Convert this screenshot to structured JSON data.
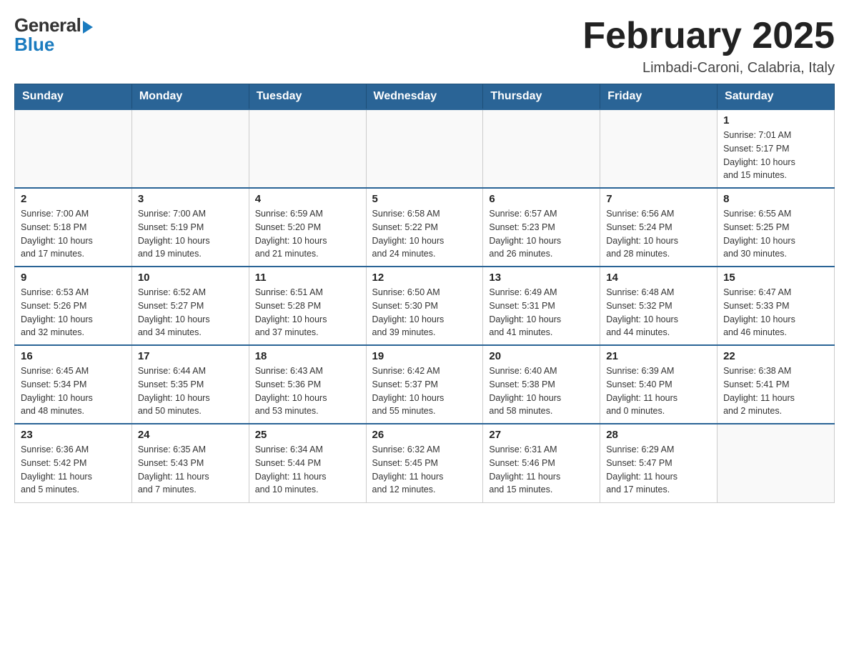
{
  "header": {
    "logo": {
      "general": "General",
      "blue": "Blue"
    },
    "title": "February 2025",
    "subtitle": "Limbadi-Caroni, Calabria, Italy"
  },
  "weekdays": [
    "Sunday",
    "Monday",
    "Tuesday",
    "Wednesday",
    "Thursday",
    "Friday",
    "Saturday"
  ],
  "weeks": [
    [
      {
        "day": "",
        "info": ""
      },
      {
        "day": "",
        "info": ""
      },
      {
        "day": "",
        "info": ""
      },
      {
        "day": "",
        "info": ""
      },
      {
        "day": "",
        "info": ""
      },
      {
        "day": "",
        "info": ""
      },
      {
        "day": "1",
        "info": "Sunrise: 7:01 AM\nSunset: 5:17 PM\nDaylight: 10 hours\nand 15 minutes."
      }
    ],
    [
      {
        "day": "2",
        "info": "Sunrise: 7:00 AM\nSunset: 5:18 PM\nDaylight: 10 hours\nand 17 minutes."
      },
      {
        "day": "3",
        "info": "Sunrise: 7:00 AM\nSunset: 5:19 PM\nDaylight: 10 hours\nand 19 minutes."
      },
      {
        "day": "4",
        "info": "Sunrise: 6:59 AM\nSunset: 5:20 PM\nDaylight: 10 hours\nand 21 minutes."
      },
      {
        "day": "5",
        "info": "Sunrise: 6:58 AM\nSunset: 5:22 PM\nDaylight: 10 hours\nand 24 minutes."
      },
      {
        "day": "6",
        "info": "Sunrise: 6:57 AM\nSunset: 5:23 PM\nDaylight: 10 hours\nand 26 minutes."
      },
      {
        "day": "7",
        "info": "Sunrise: 6:56 AM\nSunset: 5:24 PM\nDaylight: 10 hours\nand 28 minutes."
      },
      {
        "day": "8",
        "info": "Sunrise: 6:55 AM\nSunset: 5:25 PM\nDaylight: 10 hours\nand 30 minutes."
      }
    ],
    [
      {
        "day": "9",
        "info": "Sunrise: 6:53 AM\nSunset: 5:26 PM\nDaylight: 10 hours\nand 32 minutes."
      },
      {
        "day": "10",
        "info": "Sunrise: 6:52 AM\nSunset: 5:27 PM\nDaylight: 10 hours\nand 34 minutes."
      },
      {
        "day": "11",
        "info": "Sunrise: 6:51 AM\nSunset: 5:28 PM\nDaylight: 10 hours\nand 37 minutes."
      },
      {
        "day": "12",
        "info": "Sunrise: 6:50 AM\nSunset: 5:30 PM\nDaylight: 10 hours\nand 39 minutes."
      },
      {
        "day": "13",
        "info": "Sunrise: 6:49 AM\nSunset: 5:31 PM\nDaylight: 10 hours\nand 41 minutes."
      },
      {
        "day": "14",
        "info": "Sunrise: 6:48 AM\nSunset: 5:32 PM\nDaylight: 10 hours\nand 44 minutes."
      },
      {
        "day": "15",
        "info": "Sunrise: 6:47 AM\nSunset: 5:33 PM\nDaylight: 10 hours\nand 46 minutes."
      }
    ],
    [
      {
        "day": "16",
        "info": "Sunrise: 6:45 AM\nSunset: 5:34 PM\nDaylight: 10 hours\nand 48 minutes."
      },
      {
        "day": "17",
        "info": "Sunrise: 6:44 AM\nSunset: 5:35 PM\nDaylight: 10 hours\nand 50 minutes."
      },
      {
        "day": "18",
        "info": "Sunrise: 6:43 AM\nSunset: 5:36 PM\nDaylight: 10 hours\nand 53 minutes."
      },
      {
        "day": "19",
        "info": "Sunrise: 6:42 AM\nSunset: 5:37 PM\nDaylight: 10 hours\nand 55 minutes."
      },
      {
        "day": "20",
        "info": "Sunrise: 6:40 AM\nSunset: 5:38 PM\nDaylight: 10 hours\nand 58 minutes."
      },
      {
        "day": "21",
        "info": "Sunrise: 6:39 AM\nSunset: 5:40 PM\nDaylight: 11 hours\nand 0 minutes."
      },
      {
        "day": "22",
        "info": "Sunrise: 6:38 AM\nSunset: 5:41 PM\nDaylight: 11 hours\nand 2 minutes."
      }
    ],
    [
      {
        "day": "23",
        "info": "Sunrise: 6:36 AM\nSunset: 5:42 PM\nDaylight: 11 hours\nand 5 minutes."
      },
      {
        "day": "24",
        "info": "Sunrise: 6:35 AM\nSunset: 5:43 PM\nDaylight: 11 hours\nand 7 minutes."
      },
      {
        "day": "25",
        "info": "Sunrise: 6:34 AM\nSunset: 5:44 PM\nDaylight: 11 hours\nand 10 minutes."
      },
      {
        "day": "26",
        "info": "Sunrise: 6:32 AM\nSunset: 5:45 PM\nDaylight: 11 hours\nand 12 minutes."
      },
      {
        "day": "27",
        "info": "Sunrise: 6:31 AM\nSunset: 5:46 PM\nDaylight: 11 hours\nand 15 minutes."
      },
      {
        "day": "28",
        "info": "Sunrise: 6:29 AM\nSunset: 5:47 PM\nDaylight: 11 hours\nand 17 minutes."
      },
      {
        "day": "",
        "info": ""
      }
    ]
  ],
  "accent_color": "#2a6496"
}
